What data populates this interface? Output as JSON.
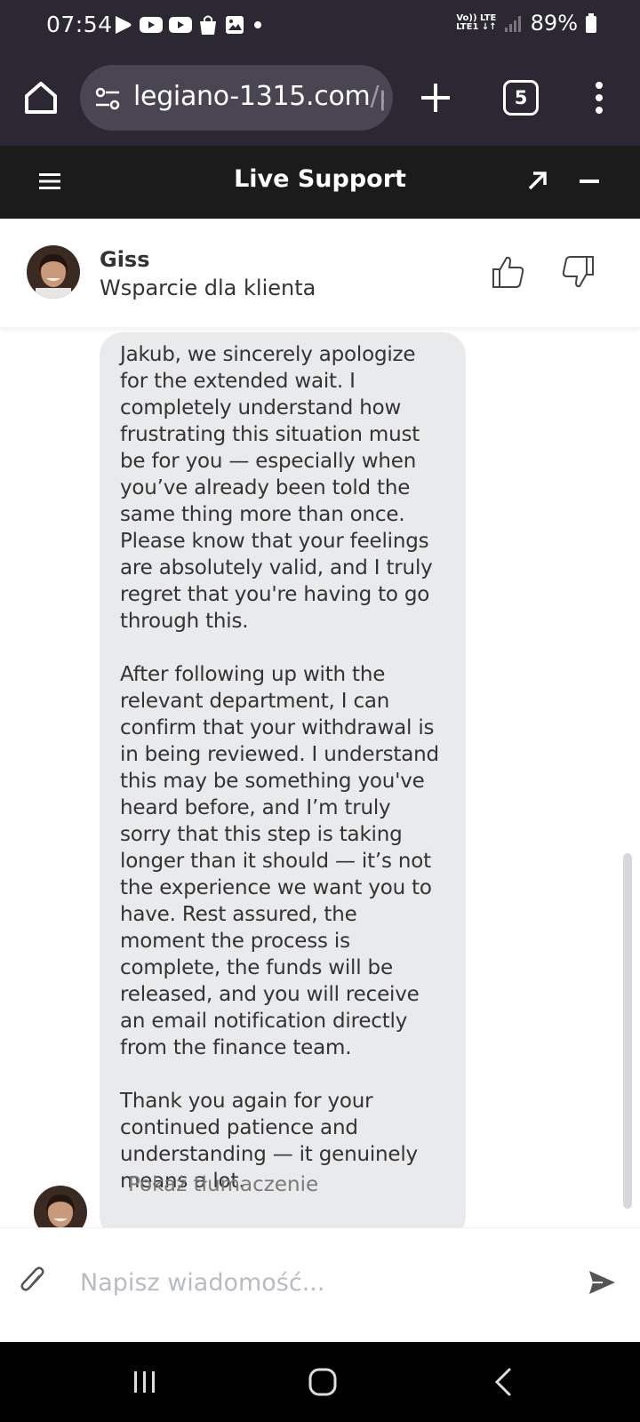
{
  "status_bar": {
    "time": "07:54",
    "network_top": "Vo)) LTE",
    "network_bottom": "LTE1 ↓↑",
    "battery": "89%"
  },
  "browser": {
    "url_main": "legiano-1315.com",
    "url_path": "/pl/",
    "tab_count": "5"
  },
  "chat": {
    "title": "Live Support"
  },
  "agent": {
    "name": "Giss",
    "role": "Wsparcie dla klienta"
  },
  "message": {
    "paragraph_1": "Jakub, we sincerely apologize for the extended wait. I completely understand how frustrating this situation must be for you — especially when you’ve already been told the same thing more than once. Please know that your feelings are absolutely valid, and I truly regret that you're having to go through this.",
    "paragraph_2": "After following up with the relevant department, I can confirm that your withdrawal is in being reviewed. I understand this may be something you've heard before, and I’m truly sorry that this step is taking longer than it should — it’s not the experience we want you to have. Rest assured, the moment the process is complete, the funds will be released, and you will receive an email notification directly from the finance team.",
    "paragraph_3": "Thank you again for your continued patience and understanding — it genuinely means a lot.",
    "translate_label": "Pokaż tłumaczenie"
  },
  "input": {
    "placeholder": "Napisz wiadomość..."
  },
  "colors": {
    "browser_bg": "#2b2733",
    "header_bg": "#1b1b1b",
    "bubble_bg": "#e9eaec",
    "text": "#333333"
  },
  "icons": [
    "home-icon",
    "site-info-icon",
    "plus-icon",
    "tabs-icon",
    "more-icon",
    "hamburger-icon",
    "expand-icon",
    "minimize-icon",
    "thumbs-up-icon",
    "thumbs-down-icon",
    "paperclip-icon",
    "send-icon",
    "recents-icon",
    "home-circle-icon",
    "back-icon"
  ]
}
